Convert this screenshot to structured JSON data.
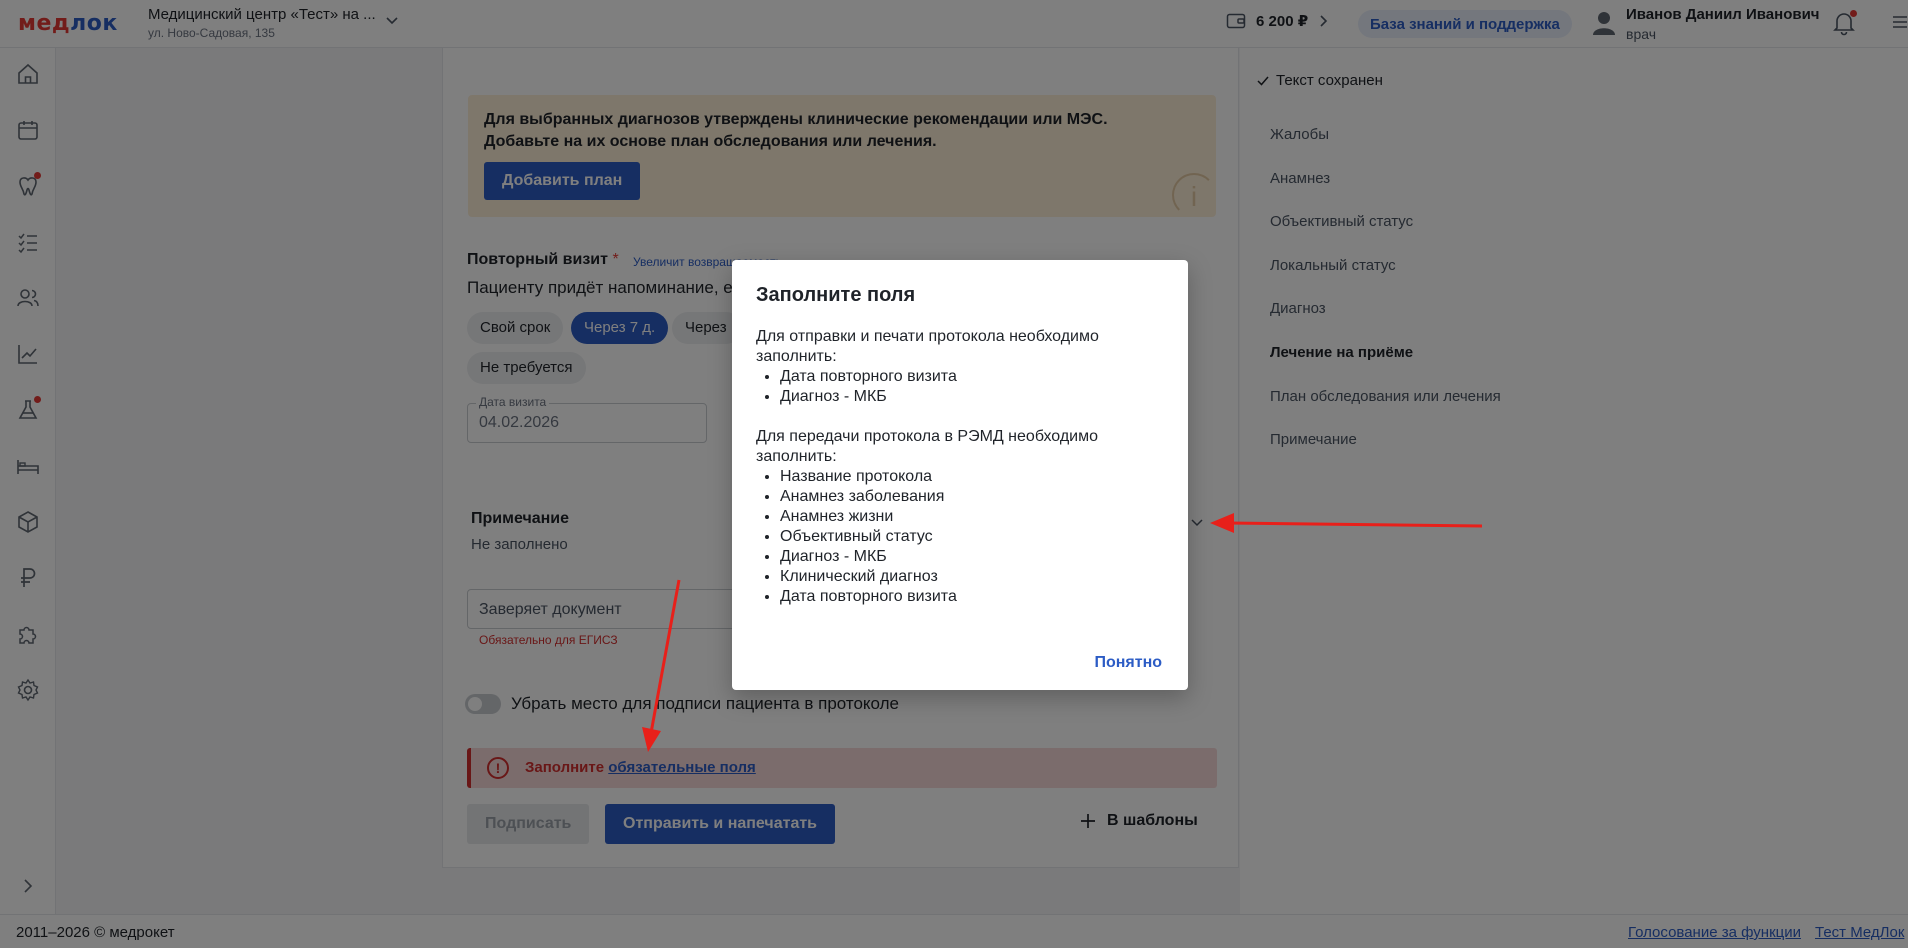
{
  "header": {
    "logo_a": "мед",
    "logo_b": "лок",
    "clinic_name": "Медицинский центр «Тест» на ...",
    "clinic_address": "ул. Ново-Садовая, 135",
    "balance": "6 200 ₽",
    "knowledge_base": "База знаний и поддержка",
    "user_name": "Иванов Даниил Иванович",
    "user_role": "врач"
  },
  "sidebar": {
    "items": [
      {
        "icon": "home-icon"
      },
      {
        "icon": "calendar-icon"
      },
      {
        "icon": "teeth-icon",
        "badge": true
      },
      {
        "icon": "checklist-icon"
      },
      {
        "icon": "users-icon"
      },
      {
        "icon": "analytics-icon"
      },
      {
        "icon": "flask-icon",
        "badge": true
      },
      {
        "icon": "bed-icon"
      },
      {
        "icon": "box-icon"
      },
      {
        "icon": "ruble-icon"
      },
      {
        "icon": "puzzle-icon"
      },
      {
        "icon": "settings-icon"
      }
    ],
    "expand_icon": "chevron-right-icon"
  },
  "main": {
    "notice_text_1": "Для выбранных диагнозов утверждены клинические рекомендации или МЭС.",
    "notice_text_2": "Добавьте на их основе план обследования или лечения.",
    "notice_button": "Добавить план",
    "repeat_visit_title": "Повторный визит",
    "repeat_visit_required": "*",
    "repeat_visit_hint": "Увеличит возвращаемость",
    "repeat_visit_desc": "Пациенту придёт напоминание, е",
    "chips": [
      "Свой срок",
      "Через 7 д.",
      "Через",
      "Не требуется"
    ],
    "active_chip": 1,
    "date_label": "Дата визита",
    "date_value": "04.02.2026",
    "note_title": "Примечание",
    "note_value": "Не заполнено",
    "certifier_placeholder": "Заверяет документ",
    "certifier_error": "Обязательно для ЕГИСЗ",
    "toggle_label": "Убрать место для подписи пациента в протоколе",
    "alert_text": "Заполните",
    "alert_link": "обязательные поля",
    "btn_sign": "Подписать",
    "btn_send": "Отправить и напечатать",
    "btn_templates": "В шаблоны"
  },
  "right_panel": {
    "saved_status": "Текст сохранен",
    "toc": [
      {
        "label": "Жалобы",
        "bold": false
      },
      {
        "label": "Анамнез",
        "bold": false
      },
      {
        "label": "Объективный статус",
        "bold": false
      },
      {
        "label": "Локальный статус",
        "bold": false
      },
      {
        "label": "Диагноз",
        "bold": false
      },
      {
        "label": "Лечение на приёме",
        "bold": true
      },
      {
        "label": "План обследования или лечения",
        "bold": false
      },
      {
        "label": "Примечание",
        "bold": false
      }
    ]
  },
  "modal": {
    "title": "Заполните поля",
    "para1": "Для отправки и печати протокола необходимо заполнить:",
    "list1": [
      "Дата повторного визита",
      "Диагноз - МКБ"
    ],
    "para2": "Для передачи протокола в РЭМД необходимо заполнить:",
    "list2": [
      "Название протокола",
      "Анамнез заболевания",
      "Анамнез жизни",
      "Объективный статус",
      "Диагноз - МКБ",
      "Клинический диагноз",
      "Дата повторного визита"
    ],
    "ok_button": "Понятно"
  },
  "footer": {
    "copyright": "2011–2026 © медрокет",
    "link_vote": "Голосование за функции",
    "link_test": "Тест МедЛок"
  },
  "colors": {
    "accent": "#2c5cc5",
    "danger": "#d32f2f",
    "notice_bg": "#fdeed7",
    "annotation_arrow": "#e8201a"
  }
}
